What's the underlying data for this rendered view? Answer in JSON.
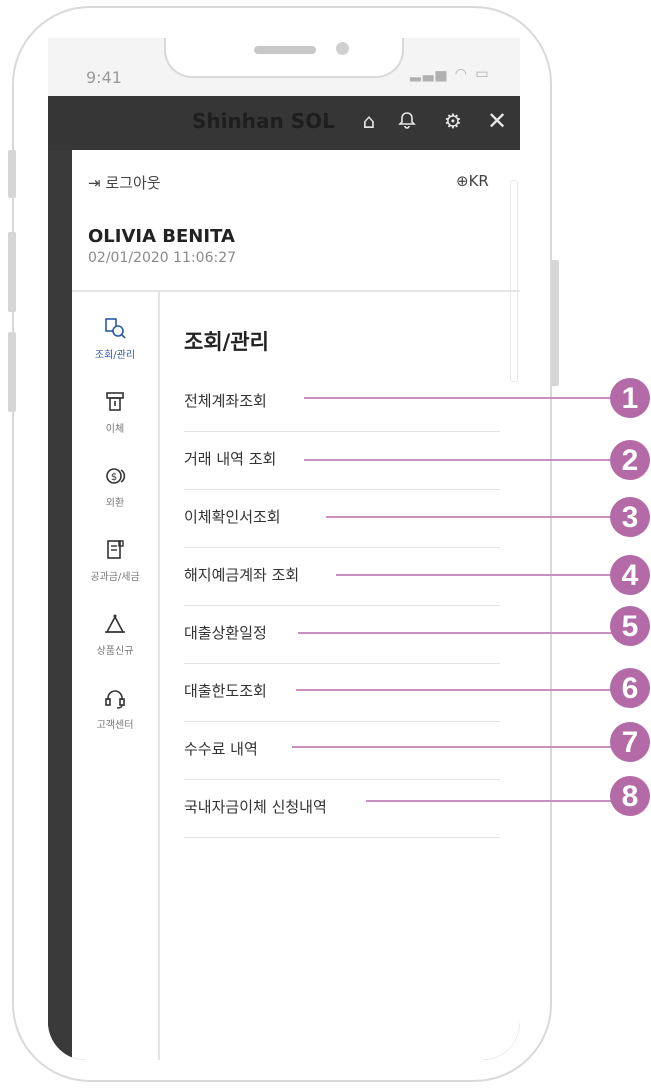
{
  "status_bar": {
    "time": "9:41",
    "icons": "signal-wifi-battery"
  },
  "app_bar": {
    "brand": "Shinhan",
    "brand_suffix": "SOL",
    "icons": [
      "home-icon",
      "bell-icon",
      "gear-icon",
      "close-icon"
    ]
  },
  "drawer": {
    "logout": "로그아웃",
    "language": "KR",
    "user_name": "OLIVIA BENITA",
    "login_time": "02/01/2020 11:06:27"
  },
  "nav": [
    {
      "label": "조회/관리",
      "icon": "search-doc-icon",
      "active": true
    },
    {
      "label": "이체",
      "icon": "transfer-icon",
      "active": false
    },
    {
      "label": "외환",
      "icon": "currency-exchange-icon",
      "active": false
    },
    {
      "label": "공과금/세금",
      "icon": "bill-icon",
      "active": false
    },
    {
      "label": "상품신규",
      "icon": "bag-icon",
      "active": false
    },
    {
      "label": "고객센터",
      "icon": "headset-icon",
      "active": false
    }
  ],
  "menu": {
    "title": "조회/관리",
    "items": [
      {
        "label": "전체계좌조회",
        "callout": "1"
      },
      {
        "label": "거래 내역 조회",
        "callout": "2"
      },
      {
        "label": "이체확인서조회",
        "callout": "3"
      },
      {
        "label": "해지예금계좌 조회",
        "callout": "4"
      },
      {
        "label": "대출상환일정",
        "callout": "5"
      },
      {
        "label": "대출한도조회",
        "callout": "6"
      },
      {
        "label": "수수료 내역",
        "callout": "7"
      },
      {
        "label": "국내자금이체 신청내역",
        "callout": "8"
      }
    ]
  },
  "colors": {
    "accent": "#2a5aa8",
    "callout": "#b36aa6",
    "callout_line": "#c98fbf"
  }
}
